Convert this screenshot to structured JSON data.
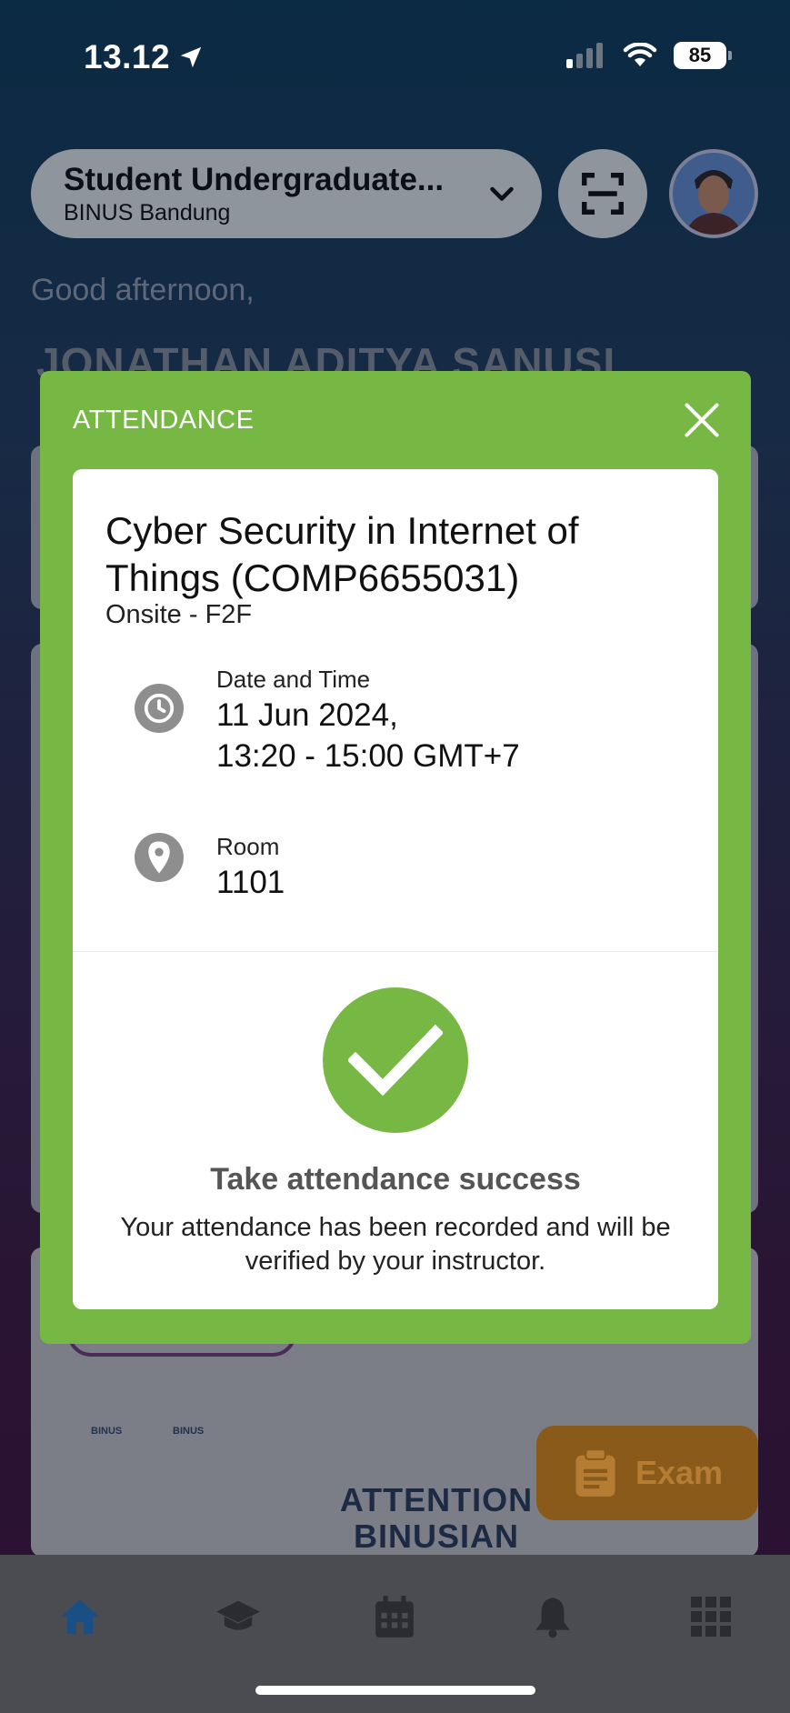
{
  "status_bar": {
    "time": "13.12",
    "battery": "85"
  },
  "header": {
    "profile_title": "Student Undergraduate...",
    "profile_subtitle": "BINUS Bandung",
    "greeting": "Good afternoon,",
    "username": "JONATHAN ADITYA SANUSI"
  },
  "background": {
    "attention_line1": "ATTENTION",
    "attention_line2": "BINUSIAN",
    "logo1": "BINUS",
    "logo2": "BINUS",
    "exam_button": "Exam"
  },
  "modal": {
    "title": "ATTENDANCE",
    "course_title": "Cyber Security in Internet of Things (COMP6655031)",
    "course_mode": "Onsite - F2F",
    "datetime_label": "Date and Time",
    "datetime_line1": "11 Jun 2024,",
    "datetime_line2": "13:20 - 15:00 GMT+7",
    "room_label": "Room",
    "room_value": "1101",
    "success_title": "Take attendance success",
    "success_message": "Your attendance has been recorded and will be verified by your instructor.",
    "accent_color": "#76b843"
  },
  "tabbar": {
    "items": [
      "home-icon",
      "graduation-cap-icon",
      "calendar-icon",
      "bell-icon",
      "grid-icon"
    ],
    "active_color": "#1a4f86",
    "inactive_color": "#2a2c31"
  }
}
